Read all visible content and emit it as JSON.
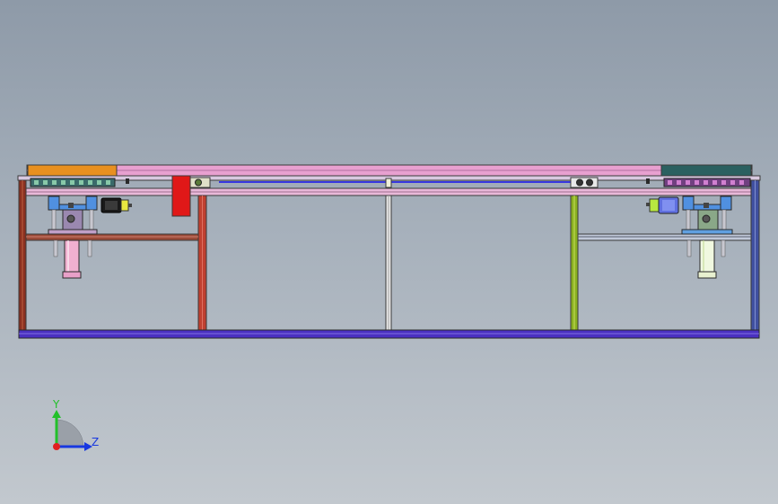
{
  "viewport": {
    "background_top": "#8e9aa8",
    "background_bottom": "#c2c8ce"
  },
  "triad": {
    "y_label": "Y",
    "z_label": "Z",
    "y_color": "#22c02a",
    "z_color": "#1838e0",
    "x_color": "#e02020"
  },
  "model": {
    "view": "front",
    "frame_color": "#3a3a3a",
    "colors": {
      "left_post": "#8a3020",
      "mid_post_left": "#c04030",
      "mid_post_center": "#d8d8d8",
      "mid_post_right": "#8ab020",
      "right_post": "#4050a0",
      "base_rail": "#4a30c0",
      "top_rail": "#e8a0d0",
      "left_block": "#e89020",
      "right_block": "#2a6060",
      "red_block": "#e01818",
      "guide_line": "#3838e0",
      "left_cylinder": "#f0b0d0",
      "right_cylinder": "#e8f0d0"
    }
  }
}
